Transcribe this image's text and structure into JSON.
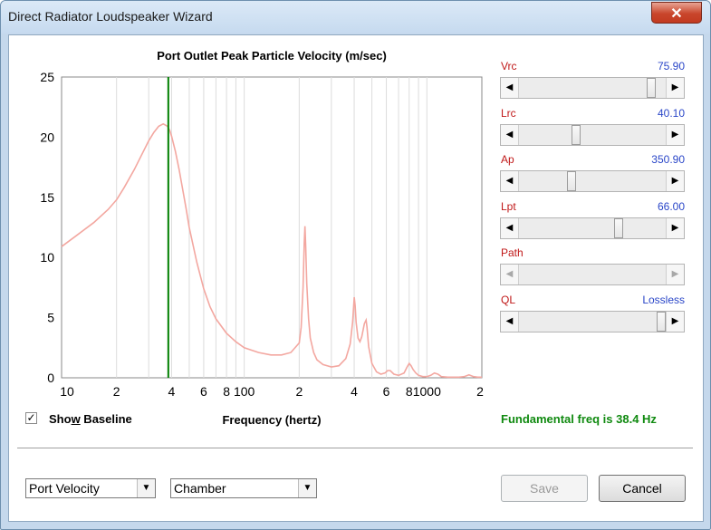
{
  "window": {
    "title": "Direct Radiator Loudspeaker Wizard",
    "close_glyph": "✕"
  },
  "chart_data": {
    "type": "line",
    "title": "Port Outlet Peak Particle Velocity (m/sec)",
    "xlabel": "Frequency (hertz)",
    "ylabel": "",
    "xscale": "log",
    "xlim": [
      10,
      2000
    ],
    "ylim": [
      0,
      25
    ],
    "yticks": [
      "0",
      "5",
      "10",
      "15",
      "20",
      "25"
    ],
    "xticks": [
      {
        "v": 10,
        "l": "10"
      },
      {
        "v": 20,
        "l": "2"
      },
      {
        "v": 40,
        "l": "4"
      },
      {
        "v": 60,
        "l": "6"
      },
      {
        "v": 80,
        "l": "8"
      },
      {
        "v": 100,
        "l": "100"
      },
      {
        "v": 200,
        "l": "2"
      },
      {
        "v": 400,
        "l": "4"
      },
      {
        "v": 600,
        "l": "6"
      },
      {
        "v": 800,
        "l": "8"
      },
      {
        "v": 1000,
        "l": "1000"
      },
      {
        "v": 2000,
        "l": "2"
      }
    ],
    "grid": true,
    "marker_x": 38.4,
    "marker_color": "#007f00",
    "series_color": "#f3a7a0",
    "series": [
      {
        "x": [
          10,
          12,
          15,
          18,
          20,
          22,
          25,
          28,
          30,
          32,
          34,
          35,
          36,
          37,
          38,
          39,
          40,
          42,
          44,
          46,
          48,
          50,
          55,
          60,
          65,
          70,
          80,
          90,
          100,
          120,
          140,
          160,
          180,
          200,
          205,
          210,
          213,
          215,
          217,
          220,
          225,
          230,
          240,
          250,
          270,
          300,
          330,
          360,
          380,
          392,
          400,
          405,
          410,
          420,
          430,
          440,
          455,
          465,
          470,
          480,
          500,
          530,
          560,
          590,
          610,
          630,
          660,
          700,
          750,
          780,
          800,
          820,
          840,
          870,
          900,
          950,
          1000,
          1050,
          1100,
          1150,
          1200,
          1300,
          1400,
          1500,
          1600,
          1700,
          1800,
          1900,
          2000
        ],
        "y": [
          10.9,
          11.8,
          12.9,
          14.0,
          14.8,
          15.8,
          17.3,
          18.8,
          19.7,
          20.4,
          20.9,
          21.0,
          21.1,
          21.0,
          20.9,
          20.6,
          20.1,
          18.8,
          17.3,
          15.7,
          14.1,
          12.5,
          9.6,
          7.4,
          5.9,
          4.9,
          3.7,
          3.0,
          2.5,
          2.1,
          1.9,
          1.9,
          2.1,
          2.9,
          4.2,
          7.5,
          11.2,
          12.6,
          11.0,
          7.8,
          4.9,
          3.3,
          2.1,
          1.5,
          1.1,
          0.9,
          1.0,
          1.6,
          2.8,
          4.6,
          6.7,
          6.0,
          4.6,
          3.3,
          3.0,
          3.4,
          4.5,
          4.8,
          4.2,
          2.6,
          1.2,
          0.5,
          0.3,
          0.4,
          0.6,
          0.6,
          0.3,
          0.2,
          0.4,
          0.9,
          1.2,
          1.0,
          0.7,
          0.4,
          0.2,
          0.1,
          0.1,
          0.2,
          0.4,
          0.3,
          0.1,
          0.05,
          0.05,
          0.05,
          0.1,
          0.25,
          0.1,
          0.05,
          0.05
        ]
      }
    ]
  },
  "sliders": [
    {
      "name": "Vrc",
      "value": "75.90",
      "position": 0.93,
      "disabled": false
    },
    {
      "name": "Lrc",
      "value": "40.10",
      "position": 0.38,
      "disabled": false
    },
    {
      "name": "Ap",
      "value": "350.90",
      "position": 0.35,
      "disabled": false
    },
    {
      "name": "Lpt",
      "value": "66.00",
      "position": 0.69,
      "disabled": false
    },
    {
      "name": "Path",
      "value": "",
      "position": null,
      "disabled": true
    },
    {
      "name": "QL",
      "value": "Lossless",
      "position": 1.0,
      "disabled": false
    }
  ],
  "show_baseline": {
    "checked": true,
    "label_pre": "Sho",
    "label_accel": "w",
    "label_post": " Baseline",
    "check_glyph": "✓"
  },
  "fundamental_text": "Fundamental freq is 38.4 Hz",
  "fundamental_color": "#108a10",
  "combo_plot": {
    "value": "Port Velocity"
  },
  "combo_location": {
    "value": "Chamber"
  },
  "dropdown_glyph": "▼",
  "arrow_left": "◀",
  "arrow_right": "▶",
  "buttons": {
    "save": "Save",
    "cancel": "Cancel"
  }
}
